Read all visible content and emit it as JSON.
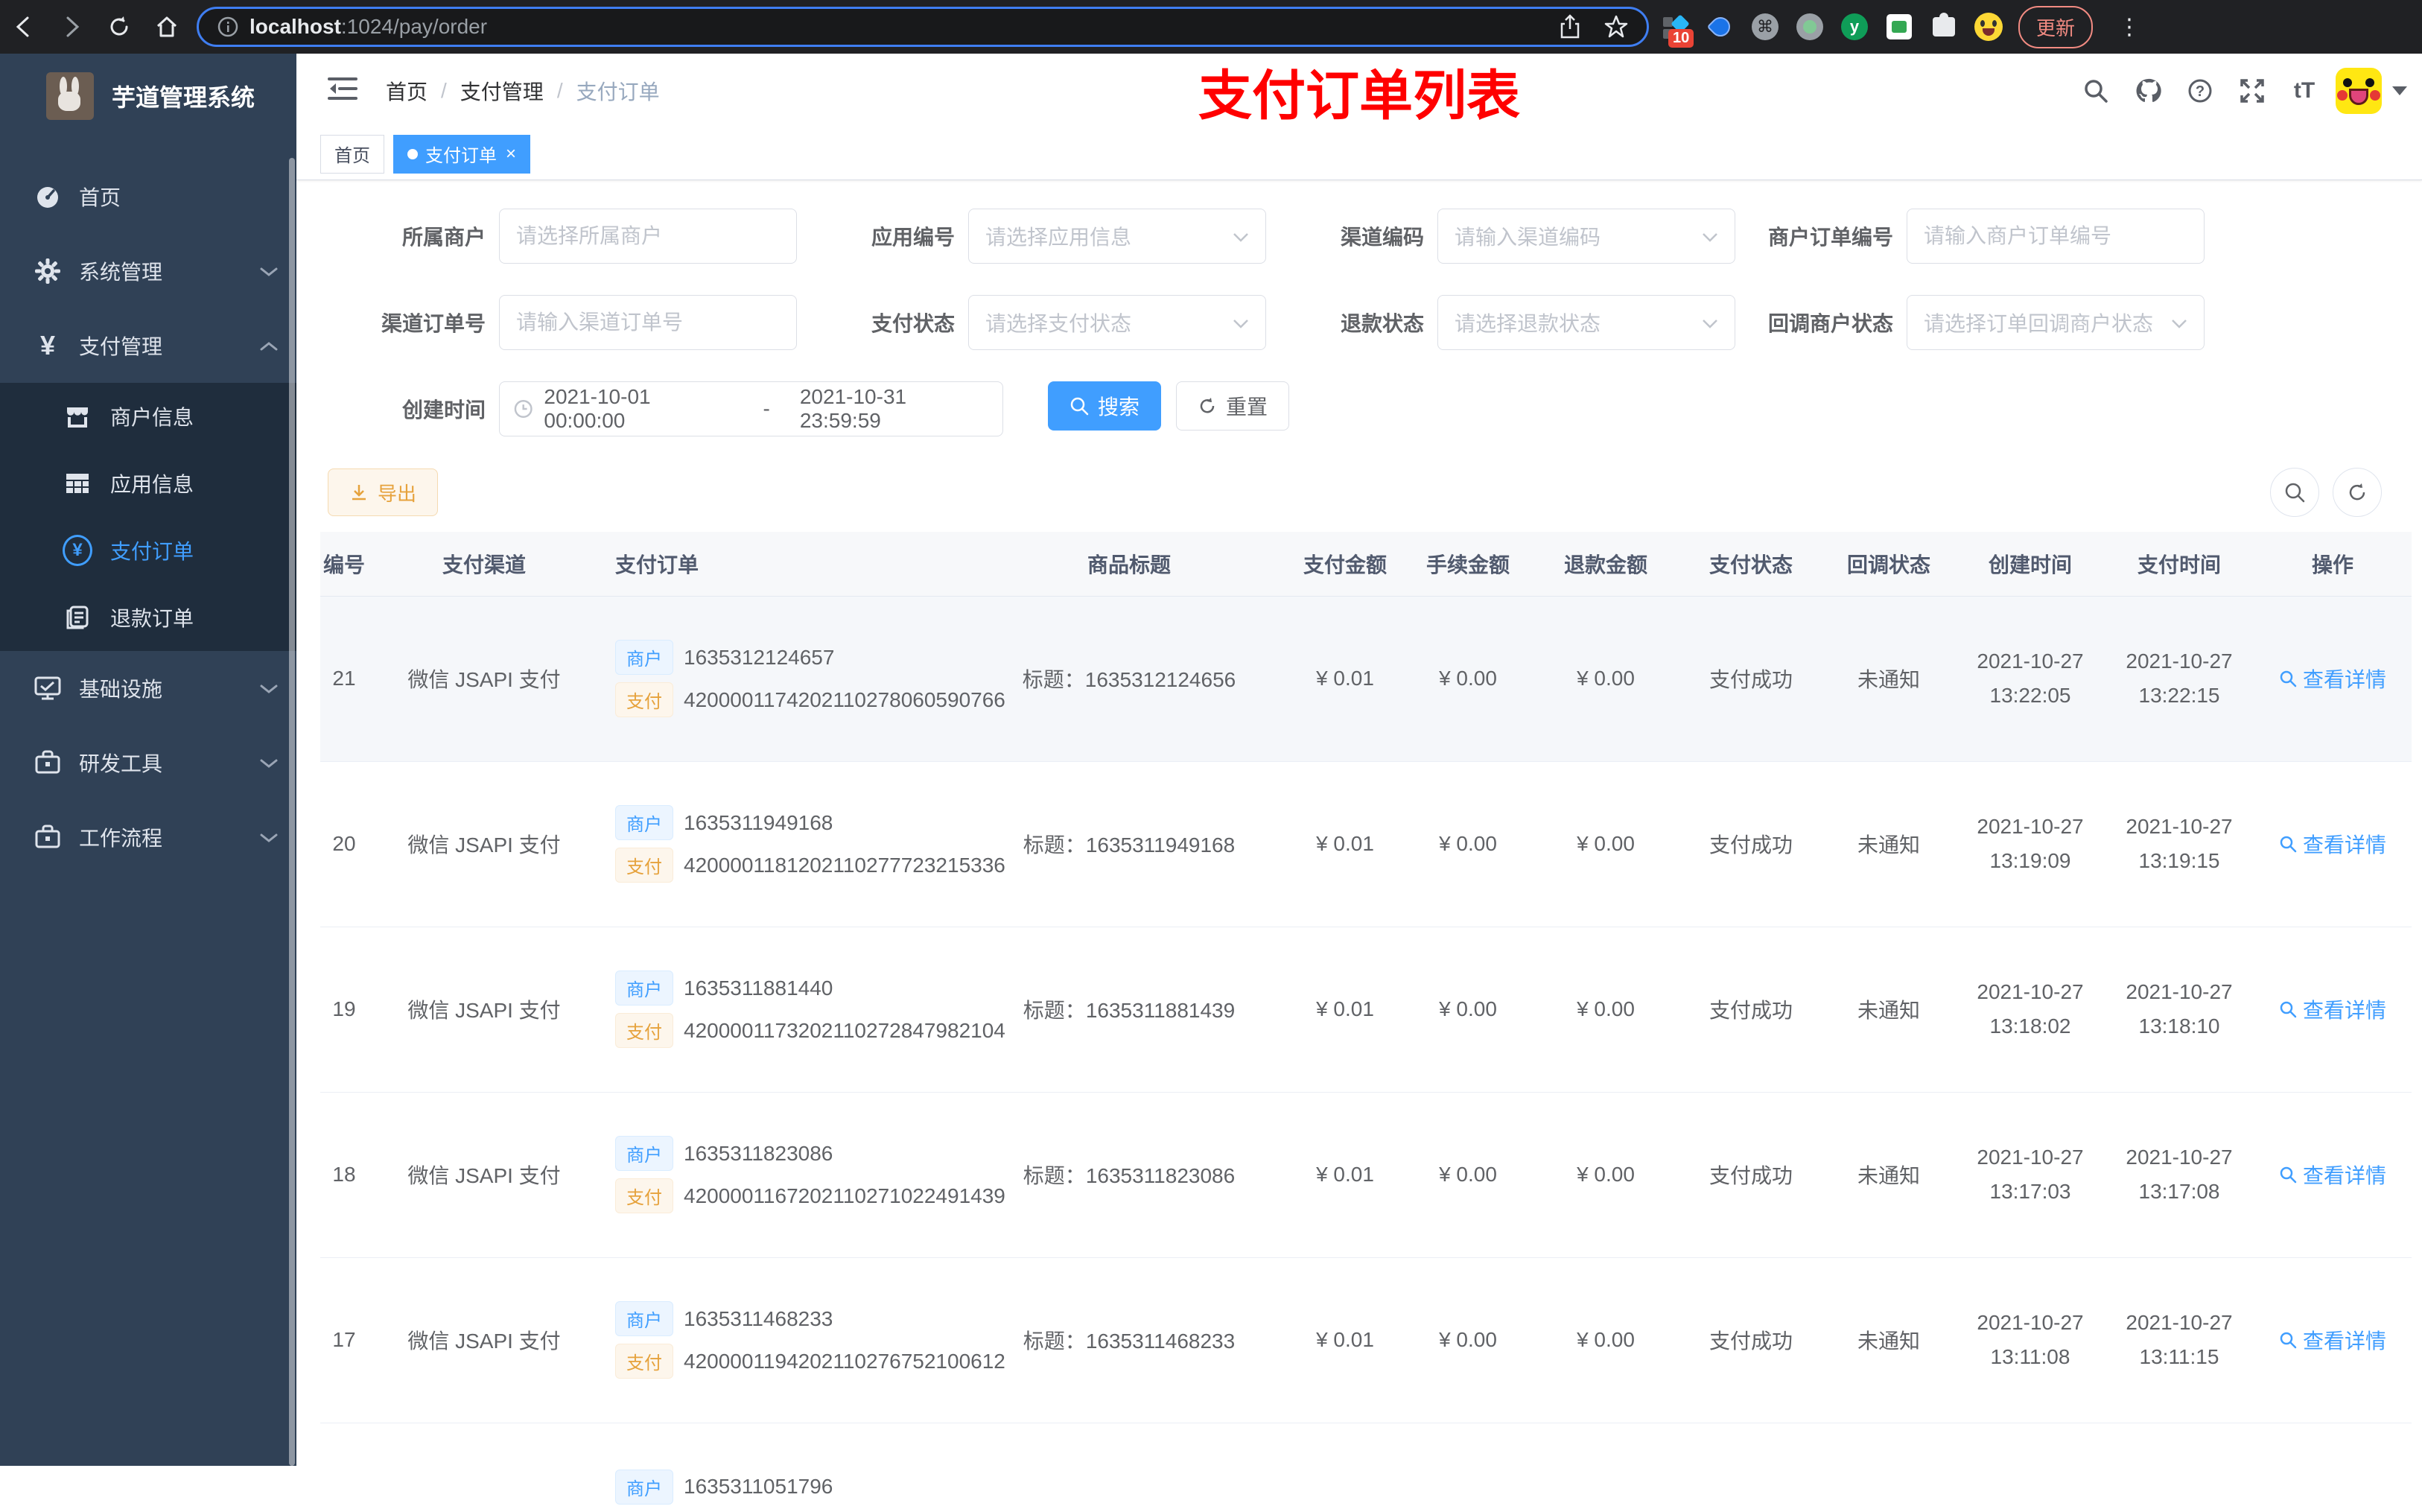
{
  "glyphs": {
    "yen": "¥",
    "command": "⌘",
    "question": "?",
    "font_size": "tT",
    "dots": "⋮",
    "info_i": "i",
    "y_ext": "y"
  },
  "browser": {
    "url_host": "localhost",
    "url_rest": ":1024/pay/order",
    "ext_badge": "10",
    "update_label": "更新"
  },
  "sidebar": {
    "app_title": "芋道管理系统",
    "items": [
      {
        "label": "首页"
      },
      {
        "label": "系统管理"
      },
      {
        "label": "支付管理"
      },
      {
        "label": "基础设施"
      },
      {
        "label": "研发工具"
      },
      {
        "label": "工作流程"
      }
    ],
    "submenu": [
      {
        "label": "商户信息"
      },
      {
        "label": "应用信息"
      },
      {
        "label": "支付订单"
      },
      {
        "label": "退款订单"
      }
    ]
  },
  "navbar": {
    "breadcrumbs": [
      "首页",
      "支付管理",
      "支付订单"
    ],
    "separator": "/",
    "overlay_title": "支付订单列表"
  },
  "tags": {
    "items": [
      {
        "label": "首页"
      },
      {
        "label": "支付订单"
      }
    ],
    "close": "×"
  },
  "filters": {
    "row1": [
      {
        "label": "所属商户",
        "placeholder": "请选择所属商户"
      },
      {
        "label": "应用编号",
        "placeholder": "请选择应用信息"
      },
      {
        "label": "渠道编码",
        "placeholder": "请输入渠道编码"
      },
      {
        "label": "商户订单编号",
        "placeholder": "请输入商户订单编号"
      }
    ],
    "row2": [
      {
        "label": "渠道订单号",
        "placeholder": "请输入渠道订单号"
      },
      {
        "label": "支付状态",
        "placeholder": "请选择支付状态"
      },
      {
        "label": "退款状态",
        "placeholder": "请选择退款状态"
      },
      {
        "label": "回调商户状态",
        "placeholder": "请选择订单回调商户状态"
      }
    ],
    "date": {
      "label": "创建时间",
      "start": "2021-10-01 00:00:00",
      "separator": "-",
      "end": "2021-10-31 23:59:59"
    },
    "search_label": "搜索",
    "reset_label": "重置"
  },
  "toolbar": {
    "export_label": "导出"
  },
  "table": {
    "columns": [
      "编号",
      "支付渠道",
      "支付订单",
      "商品标题",
      "支付金额",
      "手续金额",
      "退款金额",
      "支付状态",
      "回调状态",
      "创建时间",
      "支付时间",
      "操作"
    ],
    "merchant_tag": "商户",
    "pay_tag": "支付",
    "title_prefix": "标题：",
    "action_label": "查看详情",
    "rows": [
      {
        "id": "21",
        "channel": "微信 JSAPI 支付",
        "merchant_no": "1635312124657",
        "pay_no": "4200001174202110278060590766",
        "title": "1635312124656",
        "amount": "¥ 0.01",
        "fee": "¥ 0.00",
        "refund": "¥ 0.00",
        "status": "支付成功",
        "notify": "未通知",
        "create_date": "2021-10-27",
        "create_time": "13:22:05",
        "pay_date": "2021-10-27",
        "pay_time": "13:22:15"
      },
      {
        "id": "20",
        "channel": "微信 JSAPI 支付",
        "merchant_no": "1635311949168",
        "pay_no": "4200001181202110277723215336",
        "title": "1635311949168",
        "amount": "¥ 0.01",
        "fee": "¥ 0.00",
        "refund": "¥ 0.00",
        "status": "支付成功",
        "notify": "未通知",
        "create_date": "2021-10-27",
        "create_time": "13:19:09",
        "pay_date": "2021-10-27",
        "pay_time": "13:19:15"
      },
      {
        "id": "19",
        "channel": "微信 JSAPI 支付",
        "merchant_no": "1635311881440",
        "pay_no": "4200001173202110272847982104",
        "title": "1635311881439",
        "amount": "¥ 0.01",
        "fee": "¥ 0.00",
        "refund": "¥ 0.00",
        "status": "支付成功",
        "notify": "未通知",
        "create_date": "2021-10-27",
        "create_time": "13:18:02",
        "pay_date": "2021-10-27",
        "pay_time": "13:18:10"
      },
      {
        "id": "18",
        "channel": "微信 JSAPI 支付",
        "merchant_no": "1635311823086",
        "pay_no": "4200001167202110271022491439",
        "title": "1635311823086",
        "amount": "¥ 0.01",
        "fee": "¥ 0.00",
        "refund": "¥ 0.00",
        "status": "支付成功",
        "notify": "未通知",
        "create_date": "2021-10-27",
        "create_time": "13:17:03",
        "pay_date": "2021-10-27",
        "pay_time": "13:17:08"
      },
      {
        "id": "17",
        "channel": "微信 JSAPI 支付",
        "merchant_no": "1635311468233",
        "pay_no": "4200001194202110276752100612",
        "title": "1635311468233",
        "amount": "¥ 0.01",
        "fee": "¥ 0.00",
        "refund": "¥ 0.00",
        "status": "支付成功",
        "notify": "未通知",
        "create_date": "2021-10-27",
        "create_time": "13:11:08",
        "pay_date": "2021-10-27",
        "pay_time": "13:11:15"
      }
    ],
    "partial_row": {
      "merchant_no": "1635311051796"
    }
  }
}
